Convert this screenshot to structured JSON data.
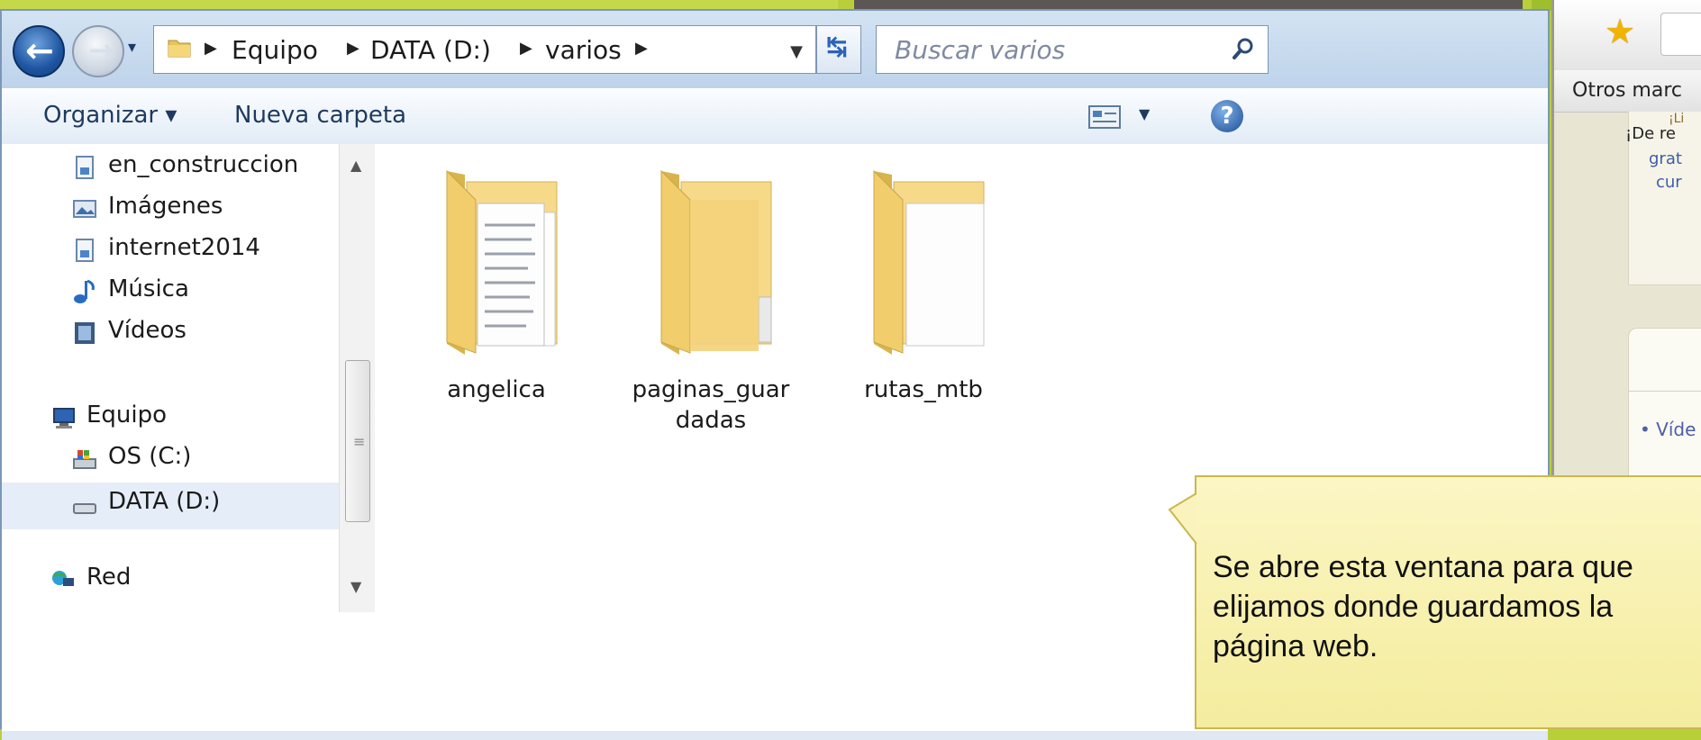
{
  "explorer": {
    "breadcrumb": [
      "Equipo",
      "DATA (D:)",
      "varios"
    ],
    "search_placeholder": "Buscar varios",
    "commands": {
      "organize": "Organizar ▾",
      "new_folder": "Nueva carpeta"
    },
    "nav_items": [
      {
        "label": "en_construccion",
        "icon": "library-icon"
      },
      {
        "label": "Imágenes",
        "icon": "pictures-icon"
      },
      {
        "label": "internet2014",
        "icon": "library-icon"
      },
      {
        "label": "Música",
        "icon": "music-icon"
      },
      {
        "label": "Vídeos",
        "icon": "videos-icon"
      },
      {
        "label": "Equipo",
        "icon": "computer-icon"
      },
      {
        "label": "OS (C:)",
        "icon": "drive-c-icon"
      },
      {
        "label": "DATA (D:)",
        "icon": "drive-d-icon"
      },
      {
        "label": "Red",
        "icon": "network-icon"
      }
    ],
    "folders": [
      {
        "name": "angelica"
      },
      {
        "name": "paginas_guardadas"
      },
      {
        "name": "rutas_mtb"
      }
    ]
  },
  "browser": {
    "bookmarks_label": "Otros marc",
    "promo_lines": [
      "¡Li",
      "¡De re",
      "grat",
      "cur"
    ],
    "list_item": "• Víde"
  },
  "tooltip": {
    "text": "Se abre esta ventana para que elijamos donde guardamos la página web."
  },
  "colors": {
    "background_green": "#b9cf3a",
    "tooltip_yellow": "#f8f1b0",
    "window_blue": "#bed3ea"
  }
}
